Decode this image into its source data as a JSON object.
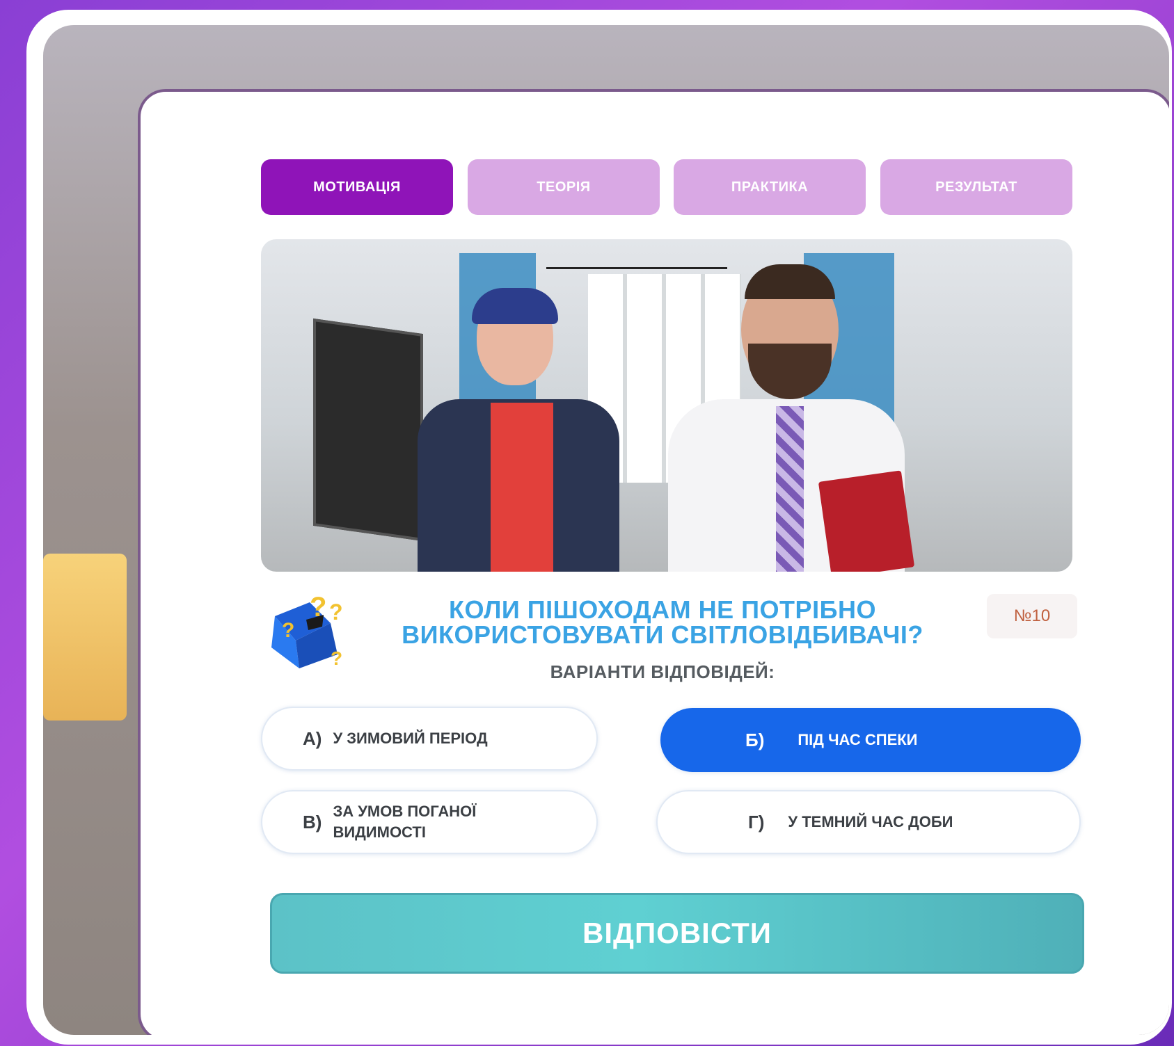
{
  "tabs": [
    {
      "label": "МОТИВАЦІЯ",
      "active": true
    },
    {
      "label": "ТЕОРІЯ",
      "active": false
    },
    {
      "label": "ПРАКТИКА",
      "active": false
    },
    {
      "label": "РЕЗУЛЬТАТ",
      "active": false
    }
  ],
  "question": {
    "line1": "КОЛИ ПІШОХОДАМ НЕ ПОТРІБНО",
    "line2": "ВИКОРИСТОВУВАТИ СВІТЛОВІДБИВАЧІ?",
    "variants_label": "ВАРІАНТИ ВІДПОВІДЕЙ:",
    "number": "№10"
  },
  "options": [
    {
      "letter": "А)",
      "text": "У ЗИМОВИЙ ПЕРІОД",
      "selected": false
    },
    {
      "letter": "Б)",
      "text": "ПІД ЧАС СПЕКИ",
      "selected": true
    },
    {
      "letter": "В)",
      "text_line1": "ЗА УМОВ ПОГАНОЇ",
      "text_line2": "ВИДИМОСТІ",
      "selected": false
    },
    {
      "letter": "Г)",
      "text": "У ТЕМНИЙ ЧАС ДОБИ",
      "selected": false
    }
  ],
  "submit_label": "ВІДПОВІСТИ",
  "colors": {
    "tab_active": "#8f14b8",
    "tab_inactive": "#d9a8e4",
    "question_text": "#3aa3e4",
    "option_selected": "#1767ea",
    "submit": "#5cc2c7"
  },
  "icons": {
    "question_box": "mystery-box-icon"
  }
}
